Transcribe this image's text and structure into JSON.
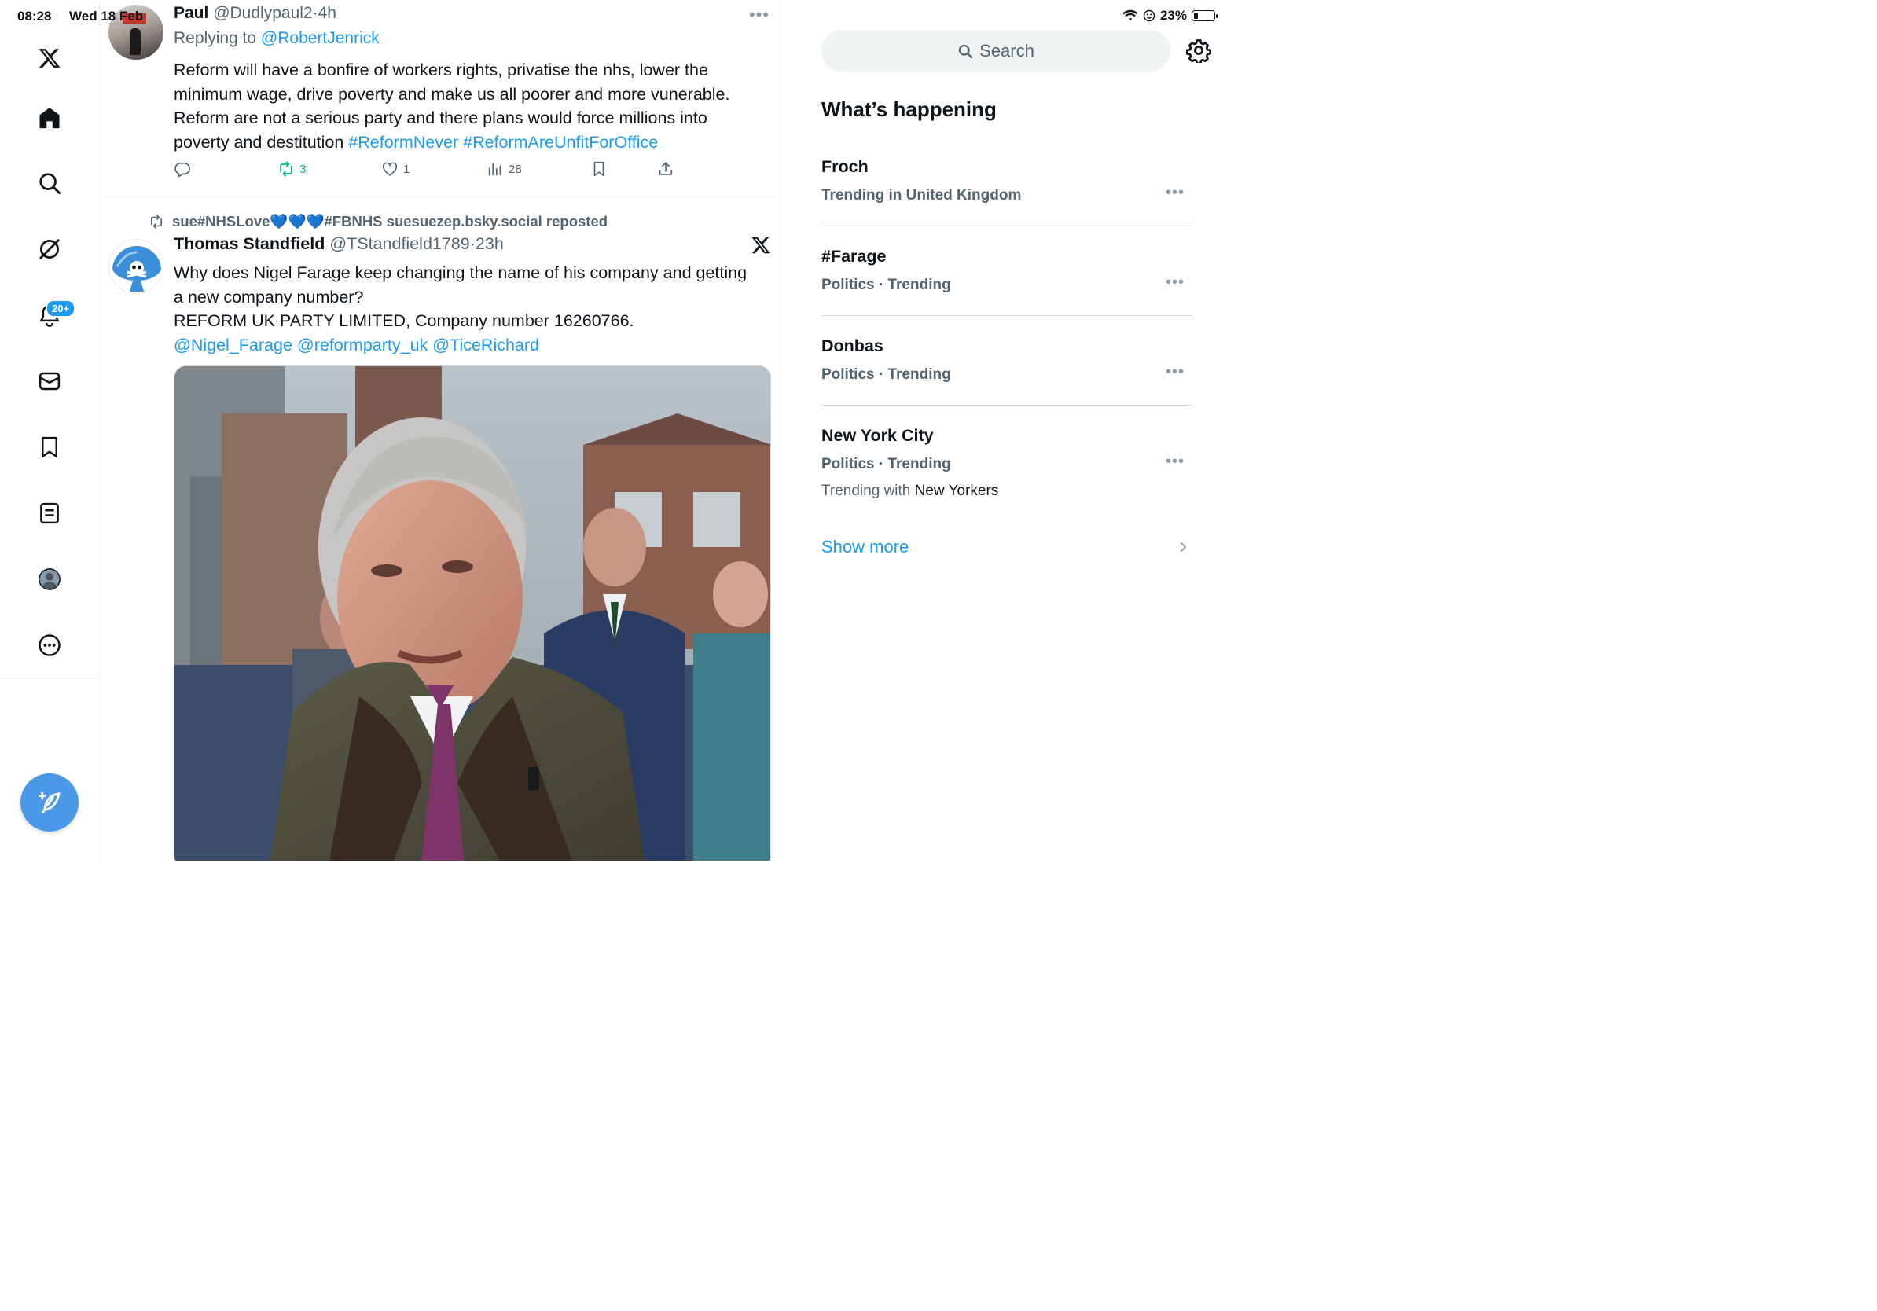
{
  "status_bar": {
    "time": "08:28",
    "date": "Wed 18 Feb",
    "battery": "23%",
    "battery_level": 0.23
  },
  "nav": {
    "notifications_badge": "20+",
    "items": [
      "x-logo",
      "home",
      "explore",
      "grok",
      "notifications",
      "messages",
      "bookmarks",
      "lists",
      "profile",
      "more"
    ]
  },
  "post1": {
    "name": "Paul",
    "handle": "@Dudlypaul2",
    "separator": "·",
    "time": "4h",
    "replying_to_label": "Replying to",
    "replying_to_handle": "@RobertJenrick",
    "text_line1": "Reform will have a bonfire of workers rights, privatise the nhs, lower the",
    "text_line2": "minimum wage, drive poverty and make us all poorer and more vunerable.",
    "text_line3": "Reform are not a serious party and there plans would force millions into",
    "text_line4": "poverty and destitution",
    "hashtag1": "#ReformNever",
    "hashtag2": "#ReformAreUnfitForOffice",
    "reposts": "3",
    "likes": "1",
    "views": "28"
  },
  "post2": {
    "repost_by": "sue#NHSLove💙💙💙#FBNHS suesuezep.bsky.social reposted",
    "name": "Thomas Standfield",
    "handle": "@TStandfield1789",
    "separator": "·",
    "time": "23h",
    "text_line1": "Why does Nigel Farage keep changing the name of his company and getting",
    "text_line2": "a new company number?",
    "text_line3": "REFORM UK PARTY LIMITED, Company number 16260766.",
    "mention1": "@Nigel_Farage",
    "mention2": "@reformparty_uk",
    "mention3": "@TiceRichard"
  },
  "right": {
    "search_placeholder": "Search",
    "whats_happening": "What’s happening",
    "trends": [
      {
        "name": "Froch",
        "meta": "Trending in United Kingdom"
      },
      {
        "name": "#Farage",
        "meta": "Politics · Trending"
      },
      {
        "name": "Donbas",
        "meta": "Politics · Trending"
      },
      {
        "name": "New York City",
        "meta": "Politics · Trending",
        "with_label": "Trending with",
        "with_value": "New Yorkers"
      }
    ],
    "show_more": "Show more"
  },
  "colors": {
    "accent": "#1d9bf0",
    "retweet_green": "#00ba7c",
    "text_primary": "#0f1419",
    "text_secondary": "#536471",
    "compose_bg": "#4a99e9"
  }
}
